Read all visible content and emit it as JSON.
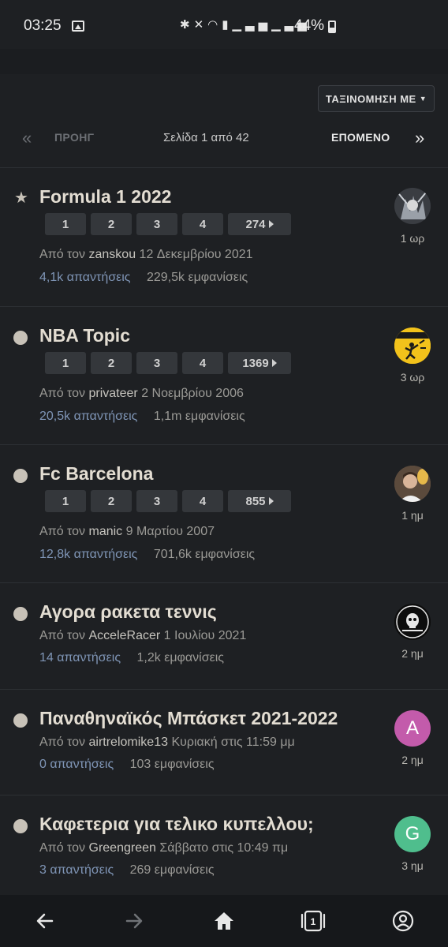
{
  "status": {
    "time": "03:25",
    "battery": "44%",
    "icons": [
      "bluetooth-icon",
      "mute-icon",
      "wifi-icon",
      "volte-icon",
      "signal-icon",
      "signal-icon"
    ]
  },
  "sort": {
    "label": "ΤΑΞΙΝΟΜΗΣΗ ΜΕ"
  },
  "pager": {
    "first": "«",
    "prev": "ΠΡΟΗΓ",
    "info": "Σελίδα 1 από 42",
    "next": "ΕΠΟΜΕΝΟ",
    "last": "»"
  },
  "colors": {
    "background": "#1e2023",
    "replies": "#7f95b6",
    "title": "#e3ddd2"
  },
  "topics": [
    {
      "title": "Formula 1 2022",
      "marker": "star",
      "pages": [
        "1",
        "2",
        "3",
        "4",
        "274"
      ],
      "by": "Από τον",
      "author": "zanskou",
      "date": "12 Δεκεμβρίου 2021",
      "replies": "4,1k απαντήσεις",
      "views": "229,5k εμφανίσεις",
      "age": "1 ωρ",
      "avatar": ""
    },
    {
      "title": "NBA Topic",
      "marker": "dot",
      "pages": [
        "1",
        "2",
        "3",
        "4",
        "1369"
      ],
      "by": "Από τον",
      "author": "privateer",
      "date": "2 Νοεμβρίου 2006",
      "replies": "20,5k απαντήσεις",
      "views": "1,1m εμφανίσεις",
      "age": "3 ωρ",
      "avatar": ""
    },
    {
      "title": "Fc Barcelona",
      "marker": "dot",
      "pages": [
        "1",
        "2",
        "3",
        "4",
        "855"
      ],
      "by": "Από τον",
      "author": "manic",
      "date": "9 Μαρτίου 2007",
      "replies": "12,8k απαντήσεις",
      "views": "701,6k εμφανίσεις",
      "age": "1 ημ",
      "avatar": ""
    },
    {
      "title": "Αγορα ρακετα τεννις",
      "marker": "dot",
      "pages": [],
      "by": "Από τον",
      "author": "AcceleRacer",
      "date": "1 Ιουλίου 2021",
      "replies": "14 απαντήσεις",
      "views": "1,2k εμφανίσεις",
      "age": "2 ημ",
      "avatar": ""
    },
    {
      "title": "Παναθηναϊκός Μπάσκετ 2021-2022",
      "marker": "dot",
      "pages": [],
      "by": "Από τον",
      "author": "airtrelomike13",
      "date": "Κυριακή στις 11:59 μμ",
      "replies": "0 απαντήσεις",
      "views": "103 εμφανίσεις",
      "age": "2 ημ",
      "avatar": "A"
    },
    {
      "title": "Καφετερια για τελικο κυπελλου;",
      "marker": "dot",
      "pages": [],
      "by": "Από τον",
      "author": "Greengreen",
      "date": "Σάββατο στις 10:49 πμ",
      "replies": "3 απαντήσεις",
      "views": "269 εμφανίσεις",
      "age": "3 ημ",
      "avatar": "G"
    }
  ],
  "navbar": {
    "icons": [
      "back-arrow-icon",
      "forward-arrow-icon",
      "home-icon",
      "tabs-icon",
      "account-icon"
    ],
    "tab_count": "1"
  }
}
